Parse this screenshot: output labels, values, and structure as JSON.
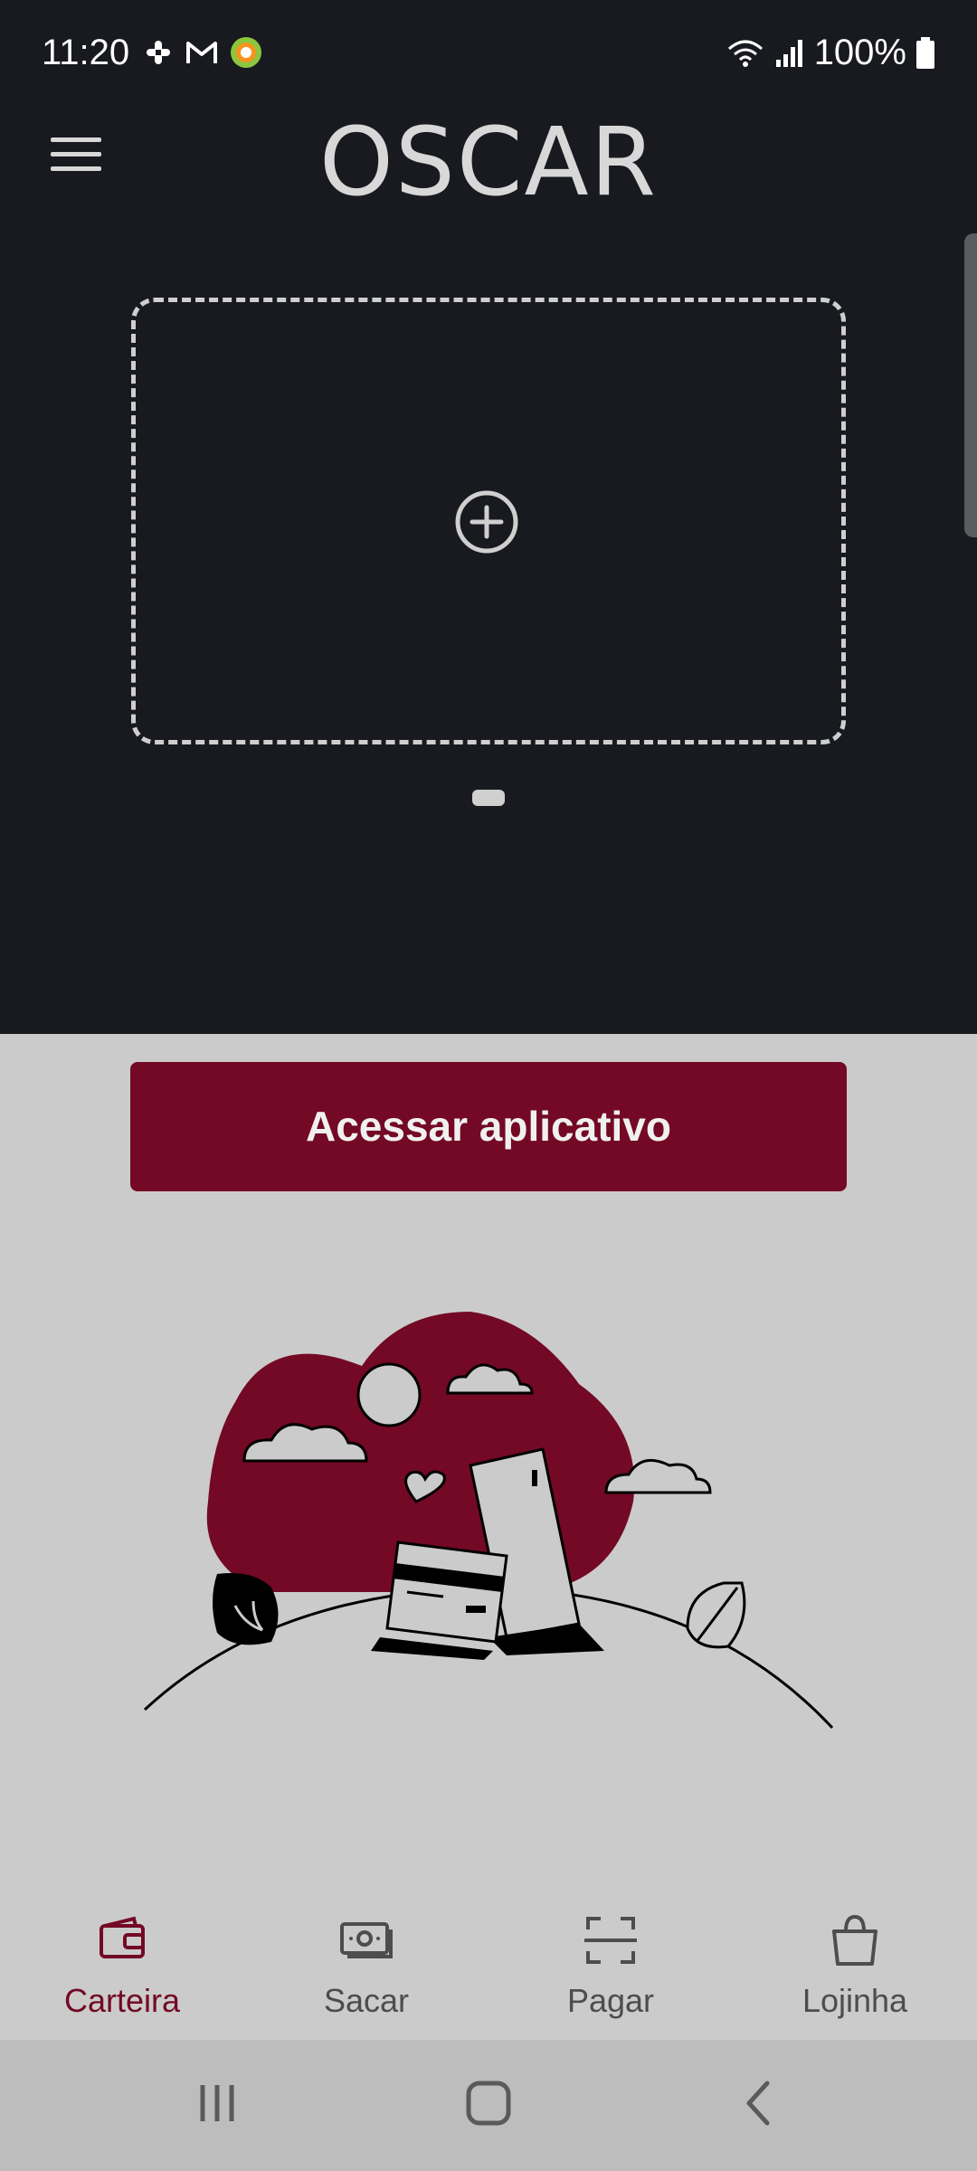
{
  "status_bar": {
    "time": "11:20",
    "battery": "100%",
    "notification_icons": [
      "slack-icon",
      "gmail-icon",
      "alelo-icon"
    ],
    "system_icons": [
      "wifi-icon",
      "signal-icon",
      "battery-icon"
    ]
  },
  "header": {
    "brand": "OSCAR",
    "menu_icon": "hamburger-icon"
  },
  "wallet": {
    "add_card_icon": "add-circle-icon"
  },
  "main": {
    "access_button_label": "Acessar aplicativo"
  },
  "bottom_nav": {
    "items": [
      {
        "label": "Carteira",
        "icon": "wallet-icon",
        "active": true
      },
      {
        "label": "Sacar",
        "icon": "cash-icon",
        "active": false
      },
      {
        "label": "Pagar",
        "icon": "scan-icon",
        "active": false
      },
      {
        "label": "Lojinha",
        "icon": "shopping-bag-icon",
        "active": false
      }
    ]
  },
  "colors": {
    "accent": "#730925",
    "header_background": "#181a20",
    "body_background": "#cbcbcb"
  }
}
